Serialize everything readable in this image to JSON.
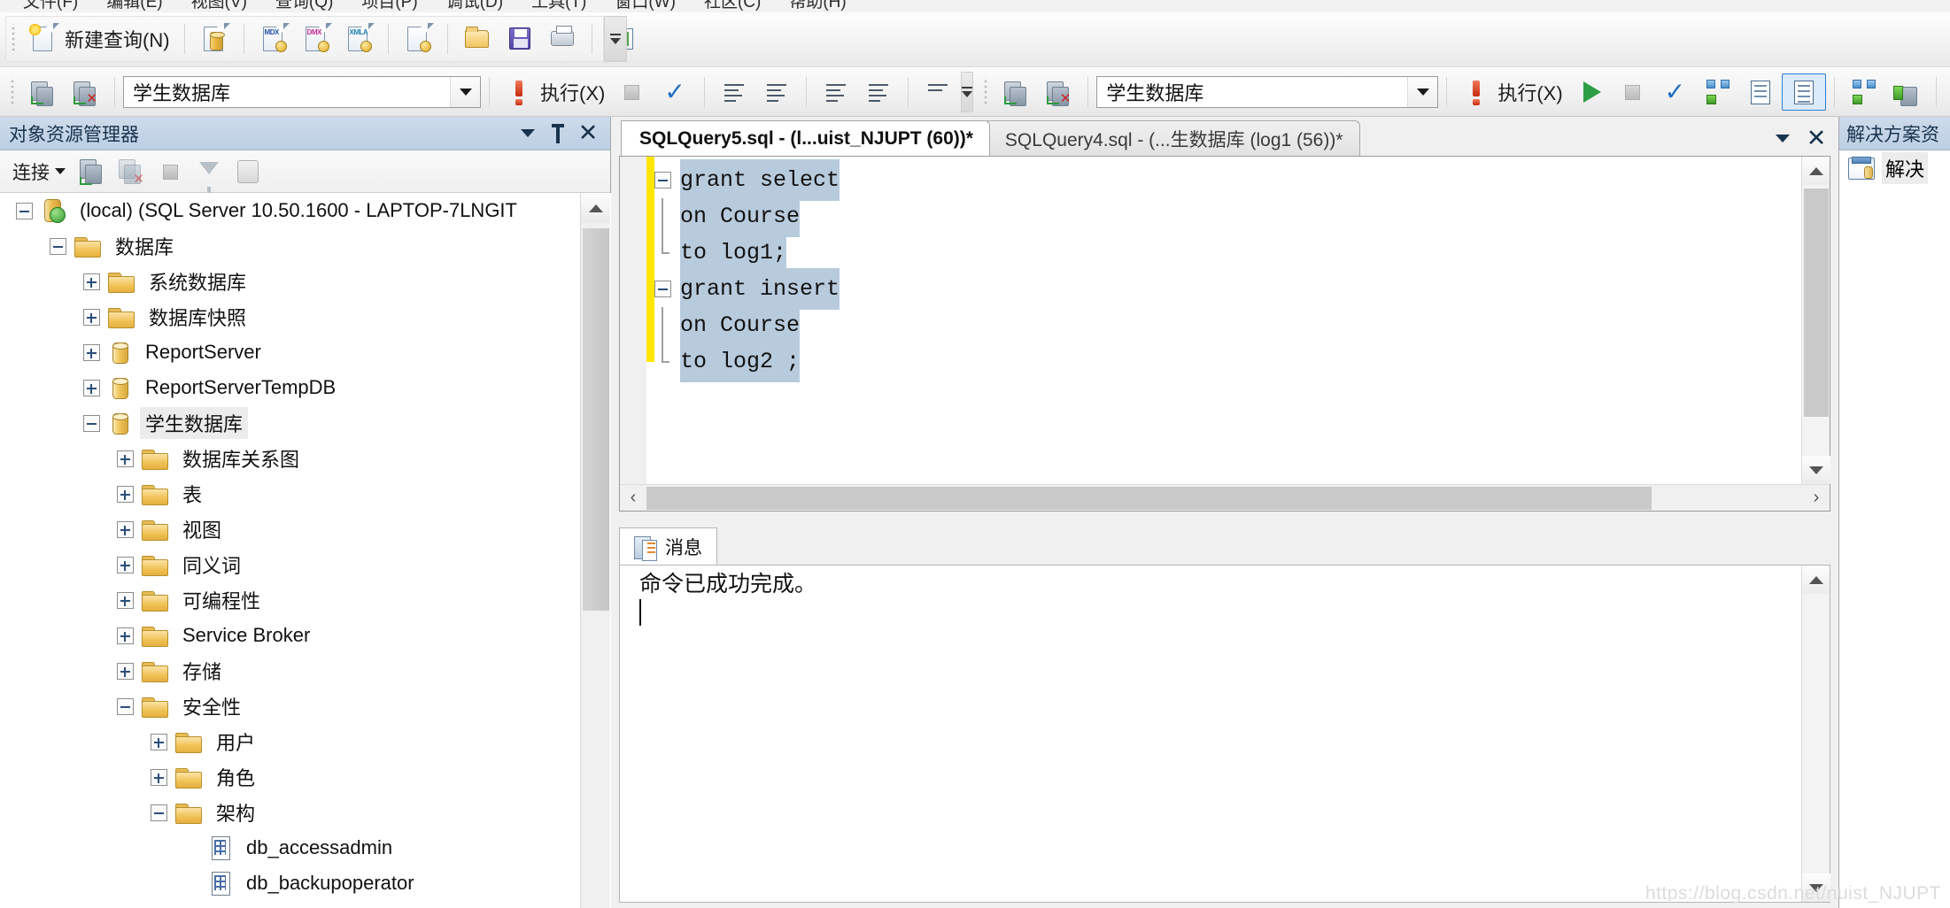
{
  "menu": {
    "items": [
      "文件(F)",
      "编辑(E)",
      "视图(V)",
      "查询(Q)",
      "项目(P)",
      "调试(D)",
      "工具(T)",
      "窗口(W)",
      "社区(C)",
      "帮助(H)"
    ]
  },
  "toolbar1": {
    "new_query_label": "新建查询(N)",
    "icons": [
      "new-query-icon",
      "new-database-engine-query-icon",
      "new-analysis-services-mdx-query-icon",
      "new-analysis-services-dmx-query-icon",
      "new-analysis-services-xmla-query-icon",
      "new-sql-server-compact-query-icon",
      "open-file-icon",
      "save-icon",
      "print-icon",
      "activity-monitor-icon"
    ],
    "overflow_label": "工具栏选项"
  },
  "toolbar2": {
    "database_value": "学生数据库",
    "execute_label": "执行(X)",
    "second_database_value": "学生数据库",
    "second_execute_label": "执行(X)",
    "icons": [
      "connect-icon",
      "disconnect-icon",
      "parse-icon",
      "debug-icon",
      "stop-icon",
      "check-icon",
      "display-estimated-execution-plan-icon",
      "query-options-icon",
      "results-to-text-icon",
      "include-actual-execution-plan-icon",
      "include-client-statistics-icon",
      "results-to-text-2-icon",
      "results-to-grid-icon",
      "results-to-file-icon",
      "comment-icon",
      "uncomment-icon"
    ]
  },
  "object_explorer": {
    "title": "对象资源管理器",
    "connect_label": "连接",
    "toolbar_icons": [
      "connect-icon",
      "disconnect-icon",
      "stop-icon",
      "filter-icon",
      "script-icon"
    ],
    "titlebar_icons": [
      "chevron-down-icon",
      "pin-icon",
      "close-icon"
    ],
    "tree": [
      {
        "label": "(local) (SQL Server 10.50.1600 - LAPTOP-7LNGIT",
        "depth": 0,
        "state": "expanded",
        "icon": "server-icon",
        "selected": false
      },
      {
        "label": "数据库",
        "depth": 1,
        "state": "expanded",
        "icon": "folder-icon",
        "selected": false
      },
      {
        "label": "系统数据库",
        "depth": 2,
        "state": "collapsed",
        "icon": "folder-icon",
        "selected": false
      },
      {
        "label": "数据库快照",
        "depth": 2,
        "state": "collapsed",
        "icon": "folder-icon",
        "selected": false
      },
      {
        "label": "ReportServer",
        "depth": 2,
        "state": "collapsed",
        "icon": "database-icon",
        "selected": false
      },
      {
        "label": "ReportServerTempDB",
        "depth": 2,
        "state": "collapsed",
        "icon": "database-icon",
        "selected": false
      },
      {
        "label": "学生数据库",
        "depth": 2,
        "state": "expanded",
        "icon": "database-icon",
        "selected": true
      },
      {
        "label": "数据库关系图",
        "depth": 3,
        "state": "collapsed",
        "icon": "folder-icon",
        "selected": false
      },
      {
        "label": "表",
        "depth": 3,
        "state": "collapsed",
        "icon": "folder-icon",
        "selected": false
      },
      {
        "label": "视图",
        "depth": 3,
        "state": "collapsed",
        "icon": "folder-icon",
        "selected": false
      },
      {
        "label": "同义词",
        "depth": 3,
        "state": "collapsed",
        "icon": "folder-icon",
        "selected": false
      },
      {
        "label": "可编程性",
        "depth": 3,
        "state": "collapsed",
        "icon": "folder-icon",
        "selected": false
      },
      {
        "label": "Service Broker",
        "depth": 3,
        "state": "collapsed",
        "icon": "folder-icon",
        "selected": false
      },
      {
        "label": "存储",
        "depth": 3,
        "state": "collapsed",
        "icon": "folder-icon",
        "selected": false
      },
      {
        "label": "安全性",
        "depth": 3,
        "state": "expanded",
        "icon": "folder-icon",
        "selected": false
      },
      {
        "label": "用户",
        "depth": 4,
        "state": "collapsed",
        "icon": "folder-icon",
        "selected": false
      },
      {
        "label": "角色",
        "depth": 4,
        "state": "collapsed",
        "icon": "folder-icon",
        "selected": false
      },
      {
        "label": "架构",
        "depth": 4,
        "state": "expanded",
        "icon": "folder-icon",
        "selected": false
      },
      {
        "label": "db_accessadmin",
        "depth": 5,
        "state": "leaf",
        "icon": "schema-icon",
        "selected": false
      },
      {
        "label": "db_backupoperator",
        "depth": 5,
        "state": "leaf",
        "icon": "schema-icon",
        "selected": false
      }
    ]
  },
  "editor": {
    "tabs": [
      {
        "label": "SQLQuery5.sql - (l...uist_NJUPT (60))*",
        "active": true
      },
      {
        "label": "SQLQuery4.sql - (...生数据库 (log1 (56))*",
        "active": false
      }
    ],
    "tab_controls": [
      "chevron-down-icon",
      "close-icon"
    ],
    "code_lines": [
      {
        "text": "grant select",
        "marker": "fold"
      },
      {
        "text": "on Course",
        "marker": "line"
      },
      {
        "text": "to log1;",
        "marker": "branch"
      },
      {
        "text": "grant insert",
        "marker": "fold"
      },
      {
        "text": "on Course",
        "marker": "line"
      },
      {
        "text": "to log2 ;",
        "marker": "end"
      }
    ]
  },
  "messages": {
    "tab_label": "消息",
    "text": "命令已成功完成。"
  },
  "right_panel": {
    "title": "解决方案资",
    "item_label": "解决"
  },
  "watermark": "https://blog.csdn.net/nuist_NJUPT",
  "colors": {
    "accent_blue": "#2a7fd4",
    "selection_blue": "#b8cbdd",
    "change_bar_yellow": "#ffe600",
    "panel_title_blue": "#bccfe3"
  }
}
